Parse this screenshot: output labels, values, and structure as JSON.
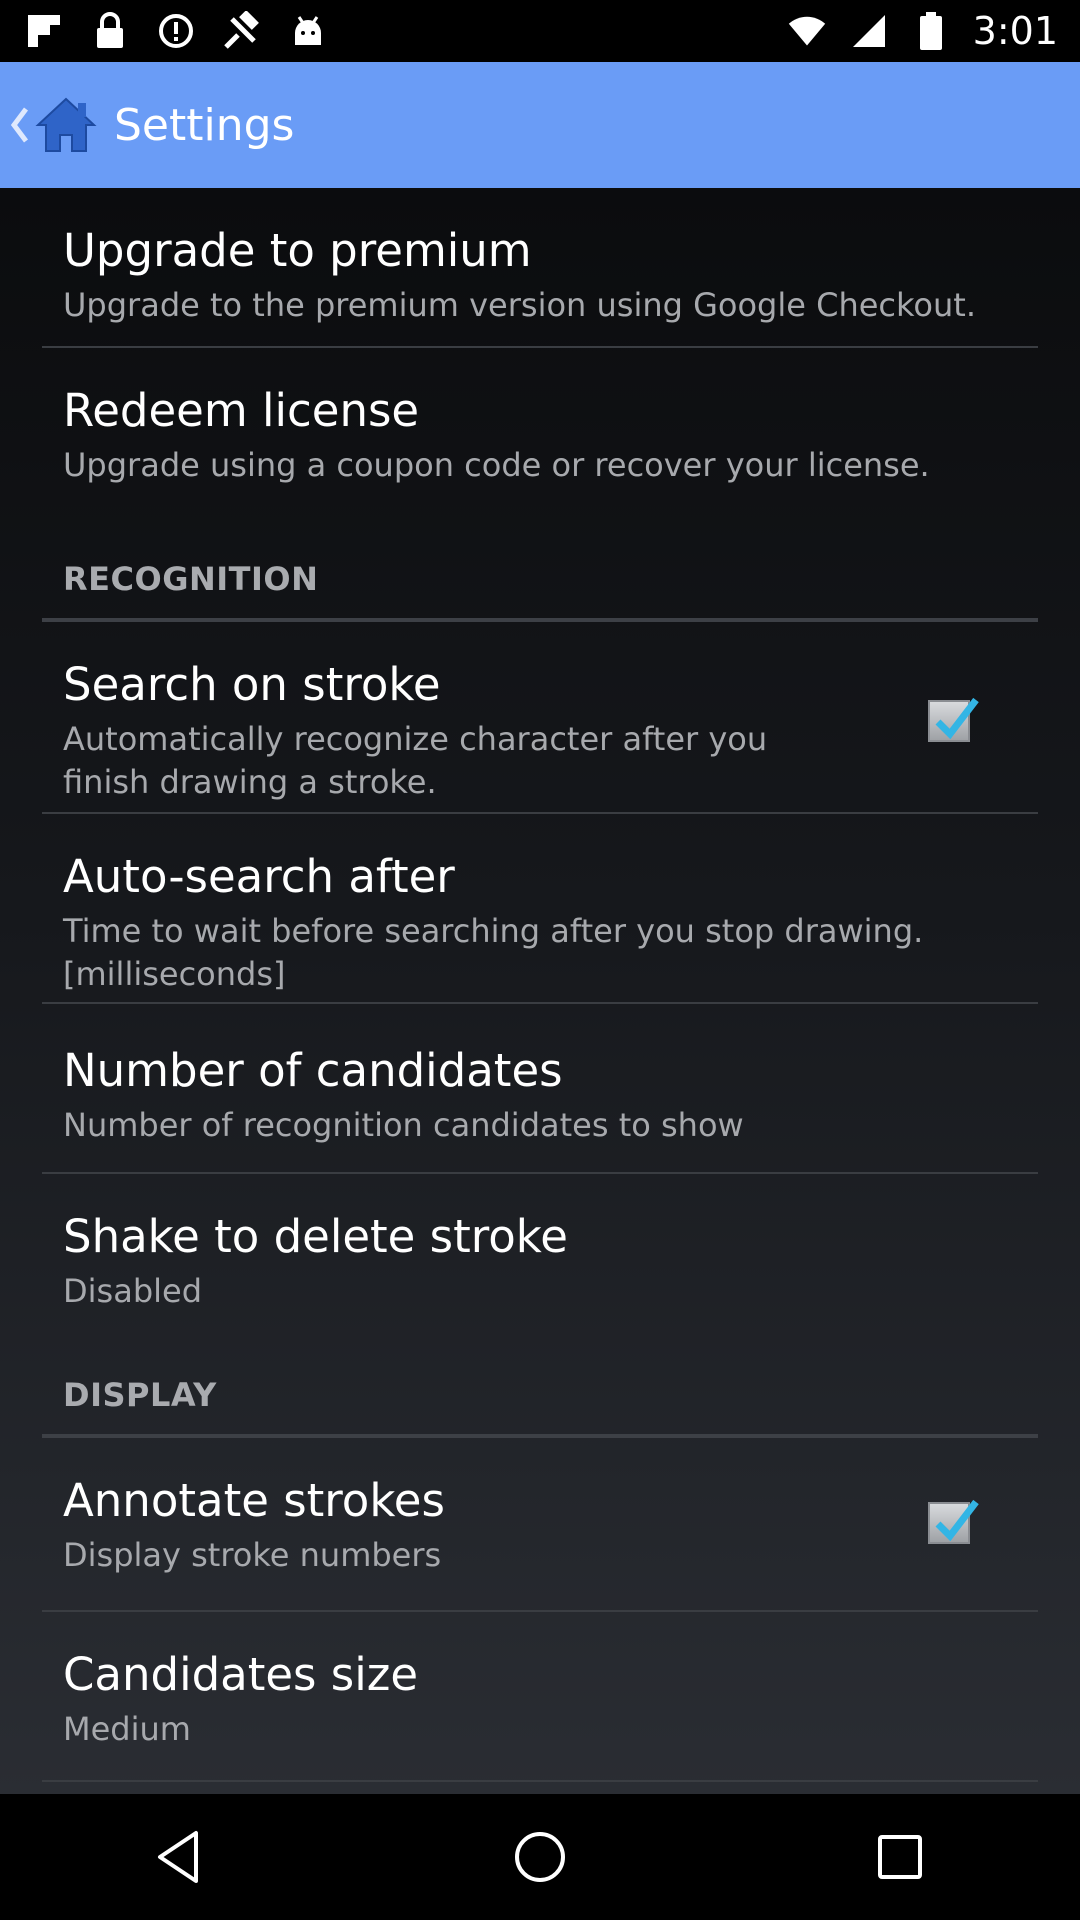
{
  "status_bar": {
    "time": "3:01",
    "icons": [
      "flipboard-icon",
      "lock-icon",
      "info-icon",
      "gps-fake-icon",
      "android-icon",
      "wifi-icon",
      "signal-icon",
      "battery-icon"
    ]
  },
  "action_bar": {
    "title": "Settings",
    "icons": [
      "chevron-left-icon",
      "home-icon"
    ],
    "color": "#6a9cf6"
  },
  "preferences": [
    {
      "title": "Upgrade to premium",
      "summary": "Upgrade to the premium version using Google Checkout."
    },
    {
      "title": "Redeem license",
      "summary": "Upgrade using a coupon code or recover your license."
    }
  ],
  "recognition": {
    "header": "RECOGNITION",
    "items": [
      {
        "title": "Search on stroke",
        "summary": "Automatically recognize character after you finish drawing a stroke.",
        "checked": true
      },
      {
        "title": "Auto-search after",
        "summary": "Time to wait before searching after you stop drawing. [milliseconds]"
      },
      {
        "title": "Number of candidates",
        "summary": "Number of recognition candidates to show"
      },
      {
        "title": "Shake to delete stroke",
        "summary": "Disabled"
      }
    ]
  },
  "display": {
    "header": "DISPLAY",
    "items": [
      {
        "title": "Annotate strokes",
        "summary": "Display stroke numbers",
        "checked": true
      },
      {
        "title": "Candidates size",
        "summary": "Medium"
      }
    ]
  },
  "nav_bar": {
    "icons": [
      "back-icon",
      "home-circle-icon",
      "recents-icon"
    ]
  },
  "colors": {
    "checkmark": "#33b5e5",
    "background": "#000000"
  }
}
